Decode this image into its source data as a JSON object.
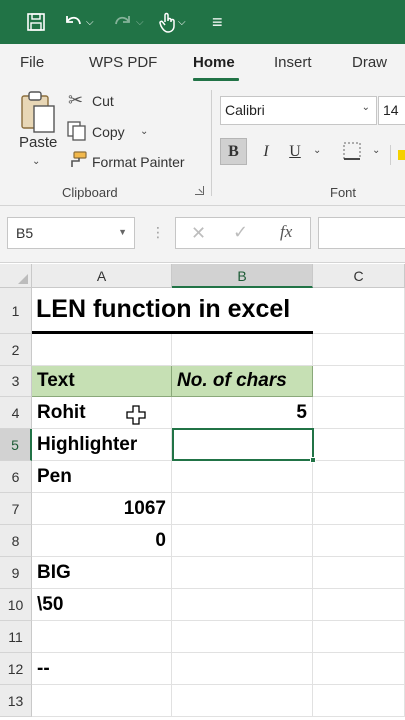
{
  "qat": {
    "icons": [
      "save-icon",
      "undo-icon",
      "redo-icon",
      "touch-mode-icon",
      "customize-qat-icon"
    ]
  },
  "tabs": [
    {
      "label": "File"
    },
    {
      "label": "WPS PDF"
    },
    {
      "label": "Home"
    },
    {
      "label": "Insert"
    },
    {
      "label": "Draw"
    }
  ],
  "active_tab": "Home",
  "accent_color": "#217346",
  "header_fill_color": "#c6e0b4",
  "ribbon": {
    "clipboard": {
      "paste": "Paste",
      "cut": "Cut",
      "copy": "Copy",
      "format_painter": "Format Painter",
      "group_label": "Clipboard"
    },
    "font": {
      "name": "Calibri",
      "size": "14",
      "bold": "B",
      "italic": "I",
      "underline": "U",
      "group_label": "Font"
    }
  },
  "formula_bar": {
    "name_box": "B5",
    "fx": "fx",
    "value": ""
  },
  "columns": [
    "A",
    "B",
    "C"
  ],
  "rows": [
    "1",
    "2",
    "3",
    "4",
    "5",
    "6",
    "7",
    "8",
    "9",
    "10",
    "11",
    "12",
    "13"
  ],
  "cells": {
    "A1": "LEN function in excel",
    "A3": "Text",
    "B3": "No. of chars",
    "A4": "Rohit",
    "B4": "5",
    "A5": "Highlighter",
    "A6": "Pen",
    "A7": "1067",
    "A8": "0",
    "A9": "BIG",
    "A10": "\\50",
    "A12": "--"
  },
  "selected_cell": "B5"
}
